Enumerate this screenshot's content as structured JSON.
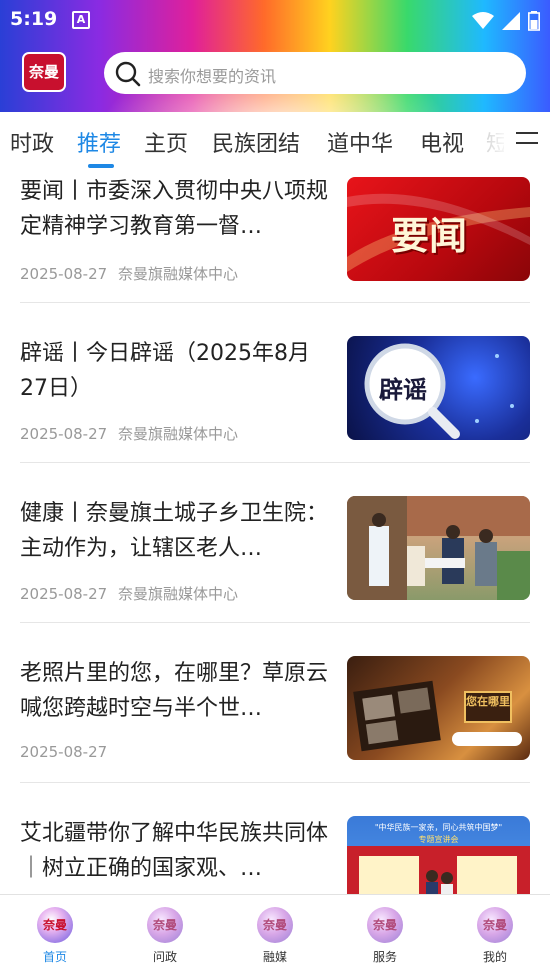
{
  "status_bar": {
    "time": "5:19",
    "notification_badge": "A"
  },
  "app": {
    "logo_text": "奈曼"
  },
  "search": {
    "placeholder": "搜索你想要的资讯"
  },
  "tabs": [
    {
      "label": "时政",
      "active": false
    },
    {
      "label": "推荐",
      "active": true
    },
    {
      "label": "主页",
      "active": false
    },
    {
      "label": "民族团结",
      "active": false
    },
    {
      "label": "道中华",
      "active": false
    },
    {
      "label": "电视",
      "active": false
    },
    {
      "label": "短",
      "active": false
    }
  ],
  "feed": [
    {
      "title": "要闻丨市委深入贯彻中央八项规定精神学习教育第一督…",
      "date": "2025-08-27",
      "source": "奈曼旗融媒体中心",
      "thumb_text": "要闻"
    },
    {
      "title": "辟谣丨今日辟谣（2025年8月27日）",
      "date": "2025-08-27",
      "source": "奈曼旗融媒体中心",
      "thumb_text": "辟谣"
    },
    {
      "title": "健康丨奈曼旗土城子乡卫生院：主动作为，让辖区老人…",
      "date": "2025-08-27",
      "source": "奈曼旗融媒体中心",
      "thumb_text": ""
    },
    {
      "title": "老照片里的您，在哪里？草原云喊您跨越时空与半个世…",
      "date": "2025-08-27",
      "source": "",
      "thumb_text": "您在哪里"
    },
    {
      "title": "艾北疆带你了解中华民族共同体｜树立正确的国家观、…",
      "date": "",
      "source": "",
      "thumb_text": "\"中华民族一家亲，同心共筑中国梦\"",
      "thumb_subtext": "专题宣讲会"
    }
  ],
  "bottom_nav": [
    {
      "label": "首页",
      "icon_text": "奈曼",
      "active": true
    },
    {
      "label": "问政",
      "icon_text": "奈曼",
      "active": false
    },
    {
      "label": "融媒",
      "icon_text": "奈曼",
      "active": false
    },
    {
      "label": "服务",
      "icon_text": "奈曼",
      "active": false
    },
    {
      "label": "我的",
      "icon_text": "奈曼",
      "active": false
    }
  ],
  "colors": {
    "accent": "#1e88e5",
    "brand": "#c8102e"
  }
}
